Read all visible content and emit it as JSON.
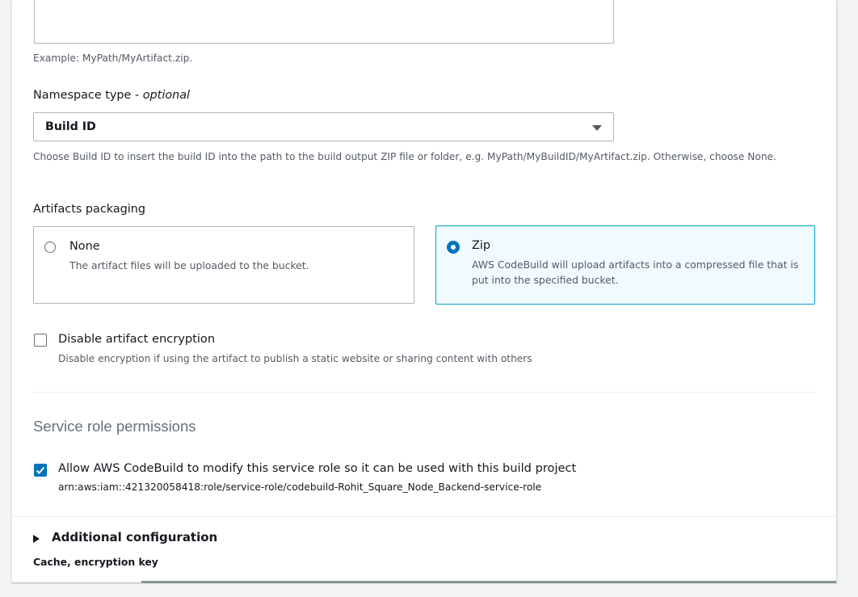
{
  "artifact_path": {
    "value": "",
    "hint": "Example: MyPath/MyArtifact.zip."
  },
  "namespace": {
    "label": "Namespace type - ",
    "label_optional": "optional",
    "selected": "Build ID",
    "hint": "Choose Build ID to insert the build ID into the path to the build output ZIP file or folder, e.g. MyPath/MyBuildID/MyArtifact.zip. Otherwise, choose None."
  },
  "packaging": {
    "label": "Artifacts packaging",
    "options": [
      {
        "title": "None",
        "description": "The artifact files will be uploaded to the bucket.",
        "selected": false
      },
      {
        "title": "Zip",
        "description": "AWS CodeBuild will upload artifacts into a compressed file that is put into the specified bucket.",
        "selected": true
      }
    ]
  },
  "encryption": {
    "title": "Disable artifact encryption",
    "description": "Disable encryption if using the artifact to publish a static website or sharing content with others",
    "checked": false
  },
  "service_role": {
    "header": "Service role permissions",
    "checkbox_label": "Allow AWS CodeBuild to modify this service role so it can be used with this build project",
    "arn": "arn:aws:iam::421320058418:role/service-role/codebuild-Rohit_Square_Node_Backend-service-role",
    "checked": true
  },
  "additional": {
    "title": "Additional configuration",
    "description": "Cache, encryption key"
  },
  "colors": {
    "accent": "#0073bb",
    "selected_border": "#00a1c9",
    "selected_bg": "#f1faff"
  }
}
